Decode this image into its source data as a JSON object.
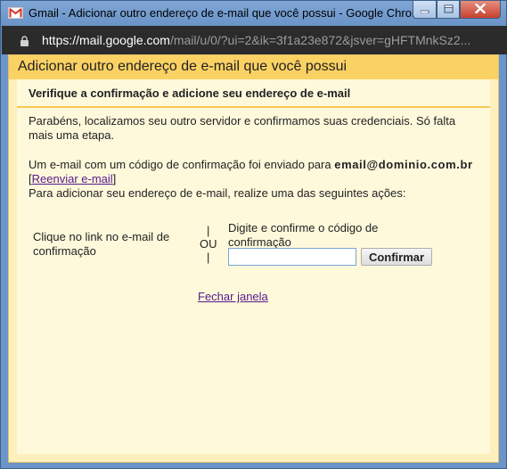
{
  "window": {
    "title": "Gmail - Adicionar outro endereço de e-mail que você possui - Google Chrome",
    "url_host": "https://mail.google.com",
    "url_rest": "/mail/u/0/?ui=2&ik=3f1a23e872&jsver=gHFTMnkSz2..."
  },
  "dialog": {
    "title": "Adicionar outro endereço de e-mail que você possui",
    "subtitle": "Verifique a confirmação e adicione seu endereço de e-mail",
    "congrats": "Parabéns, localizamos seu outro servidor e confirmamos suas credenciais. Só falta mais uma etapa.",
    "sent_text": "Um e-mail com um código de confirmação foi enviado para",
    "email": "email@dominio.com.br",
    "bracket_open": "[",
    "resend_link": "Reenviar e-mail",
    "bracket_close": "]",
    "actions_text": "Para adicionar seu endereço de e-mail, realize uma das seguintes ações:",
    "option_link": "Clique no link no e-mail de confirmação",
    "or_bar": "|",
    "or_label": "OU",
    "option_code": "Digite e confirme o código de confirmação",
    "code_value": "",
    "confirm_button": "Confirmar",
    "close_link": "Fechar janela"
  },
  "colors": {
    "header_bg": "#fad163",
    "dialog_bg": "#fdf0bd",
    "inner_bg": "#fff9dc",
    "link": "#551a8b",
    "titlebar": "#6b94c8"
  },
  "icons": {
    "app_icon": "gmail-icon",
    "lock": "lock-icon"
  }
}
